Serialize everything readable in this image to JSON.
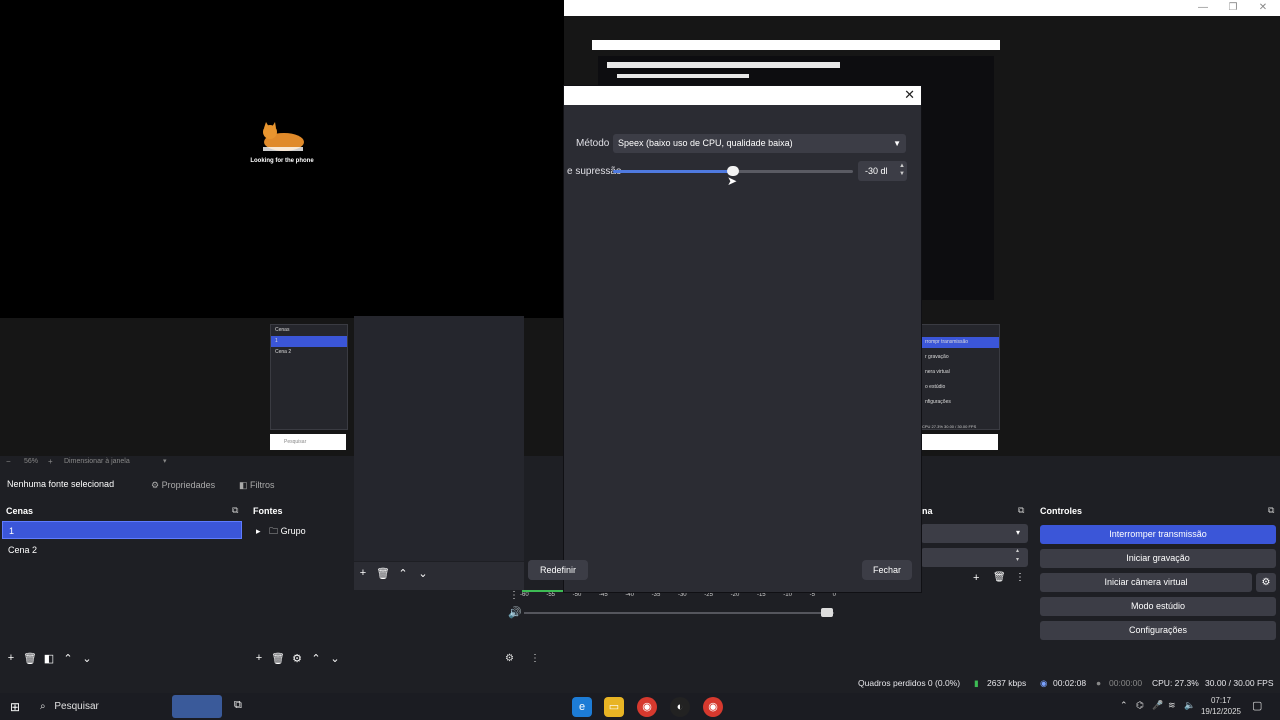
{
  "phone_screen": {
    "message": "Looking for the phone"
  },
  "dialog": {
    "method_label": "Método",
    "method_value": "Speex (baixo uso de CPU, qualidade baixa)",
    "suppression_label": "e supressão",
    "suppression_value": "-30 dB",
    "suppression_display": "-30 dl",
    "slider_level_percent": 50,
    "reset_button": "Redefinir",
    "close_button": "Fechar"
  },
  "nested_preview": {
    "scenes_title": "Cenas",
    "scenes": [
      "1",
      "Cena 2"
    ],
    "search_placeholder": "Pesquisar",
    "controls": [
      "rrompr transmissão",
      "r gravação",
      "nera virtual",
      "o estúdio",
      "nfigurações"
    ],
    "status": "CPU 27.3%   30.00 / 30.00 FPS"
  },
  "preview_toolbar": {
    "zoom": "56%",
    "resize_label": "Dimensionar à janela"
  },
  "context_bar": {
    "no_source": "Nenhuma fonte selecionad",
    "properties": "Propriedades",
    "filters": "Filtros"
  },
  "scenes_dock": {
    "title": "Cenas",
    "items": [
      "1",
      "Cena 2"
    ],
    "selected_index": 0
  },
  "sources_dock": {
    "title": "Fontes",
    "items": [
      {
        "label": "Grupo",
        "icon": "folder-icon"
      }
    ]
  },
  "audio_mixer": {
    "ticks": [
      "-60",
      "-55",
      "-50",
      "-45",
      "-40",
      "-35",
      "-30",
      "-25",
      "-20",
      "-15",
      "-10",
      "-5",
      "0"
    ]
  },
  "transitions_dock": {
    "title_fragment": "na"
  },
  "controls_dock": {
    "title": "Controles",
    "buttons": [
      {
        "label": "Interromper transmissão",
        "primary": true
      },
      {
        "label": "Iniciar gravação",
        "primary": false
      },
      {
        "label": "Iniciar câmera virtual",
        "primary": false
      },
      {
        "label": "Modo estúdio",
        "primary": false
      },
      {
        "label": "Configurações",
        "primary": false
      }
    ]
  },
  "status_bar": {
    "dropped_frames": "Quadros perdidos 0 (0.0%)",
    "bitrate": "2637 kbps",
    "stream_time": "00:02:08",
    "record_time": "00:00:00",
    "cpu": "CPU: 27.3%",
    "fps": "30.00 / 30.00 FPS"
  },
  "taskbar": {
    "search_placeholder": "Pesquisar",
    "time": "07:17",
    "date": "19/12/2025"
  },
  "colors": {
    "accent": "#3b56d8",
    "panel": "#1e1f24",
    "dialog": "#2b2c33"
  }
}
